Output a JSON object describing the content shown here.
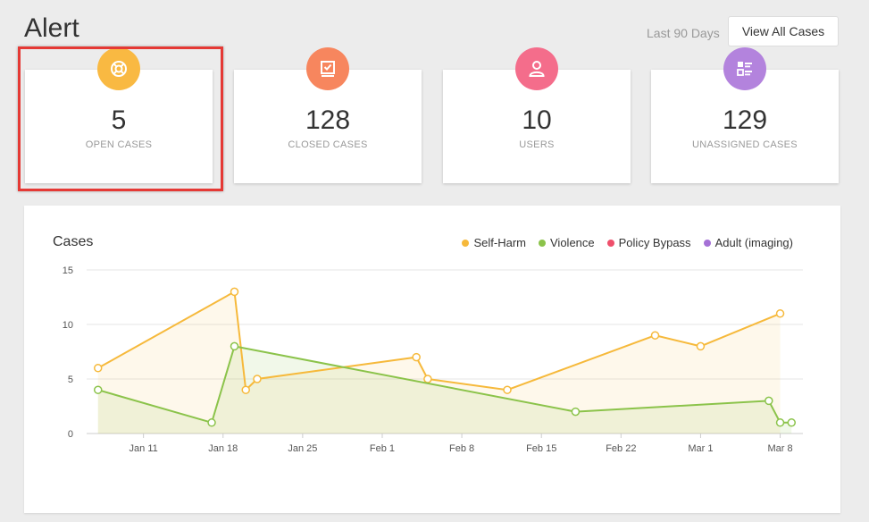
{
  "header": {
    "title": "Alert",
    "range": "Last 90 Days",
    "view_all": "View All Cases"
  },
  "cards": [
    {
      "value": "5",
      "label": "OPEN CASES",
      "color": "#f9b942",
      "icon": "lifebuoy-icon"
    },
    {
      "value": "128",
      "label": "CLOSED CASES",
      "color": "#f7865e",
      "icon": "checkbox-icon"
    },
    {
      "value": "10",
      "label": "USERS",
      "color": "#f46d8b",
      "icon": "user-icon"
    },
    {
      "value": "129",
      "label": "UNASSIGNED CASES",
      "color": "#b383dd",
      "icon": "list-icon"
    }
  ],
  "chart": {
    "title": "Cases",
    "legend": [
      {
        "label": "Self-Harm",
        "color": "#f6b93b"
      },
      {
        "label": "Violence",
        "color": "#8bc34a"
      },
      {
        "label": "Policy Bypass",
        "color": "#ef4f6b"
      },
      {
        "label": "Adult (imaging)",
        "color": "#a571d6"
      }
    ]
  },
  "chart_data": {
    "type": "area",
    "title": "Cases",
    "x_ticks": [
      "Jan 11",
      "Jan 18",
      "Jan 25",
      "Feb 1",
      "Feb 8",
      "Feb 15",
      "Feb 22",
      "Mar 1",
      "Mar 8"
    ],
    "y_ticks": [
      0,
      5,
      10,
      15
    ],
    "ylim": [
      0,
      15
    ],
    "xlim": [
      "Jan 6",
      "Mar 10"
    ],
    "series": [
      {
        "name": "Self-Harm",
        "color": "#f6b93b",
        "points": [
          {
            "x": "Jan 7",
            "y": 6
          },
          {
            "x": "Jan 19",
            "y": 13
          },
          {
            "x": "Jan 20",
            "y": 4
          },
          {
            "x": "Jan 21",
            "y": 5
          },
          {
            "x": "Feb 4",
            "y": 7
          },
          {
            "x": "Feb 5",
            "y": 5
          },
          {
            "x": "Feb 12",
            "y": 4
          },
          {
            "x": "Feb 25",
            "y": 9
          },
          {
            "x": "Mar 1",
            "y": 8
          },
          {
            "x": "Mar 8",
            "y": 11
          }
        ]
      },
      {
        "name": "Violence",
        "color": "#8bc34a",
        "points": [
          {
            "x": "Jan 7",
            "y": 4
          },
          {
            "x": "Jan 17",
            "y": 1
          },
          {
            "x": "Jan 19",
            "y": 8
          },
          {
            "x": "Feb 18",
            "y": 2
          },
          {
            "x": "Mar 7",
            "y": 3
          },
          {
            "x": "Mar 8",
            "y": 1
          },
          {
            "x": "Mar 9",
            "y": 1
          }
        ]
      }
    ],
    "grid": true,
    "legend_position": "top-right"
  }
}
